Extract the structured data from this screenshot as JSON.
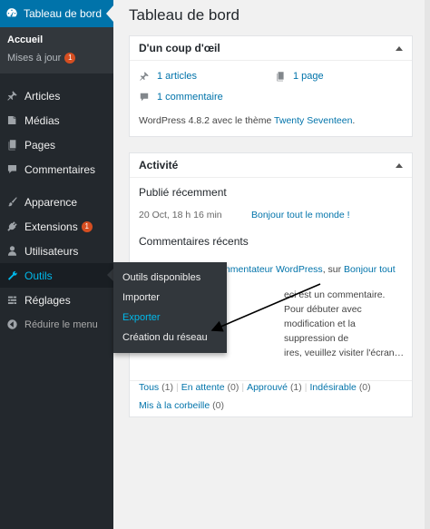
{
  "sidebar": {
    "header": {
      "label": "Tableau de bord",
      "icon": "dashboard-icon"
    },
    "submenu": [
      {
        "label": "Accueil",
        "current": true
      },
      {
        "label": "Mises à jour",
        "badge": "1"
      }
    ],
    "items": [
      {
        "label": "Articles",
        "icon": "pushpin-icon"
      },
      {
        "label": "Médias",
        "icon": "media-icon"
      },
      {
        "label": "Pages",
        "icon": "pages-icon"
      },
      {
        "label": "Commentaires",
        "icon": "comment-icon"
      },
      {
        "label": "Apparence",
        "icon": "paintbrush-icon"
      },
      {
        "label": "Extensions",
        "icon": "plugin-icon",
        "badge": "1"
      },
      {
        "label": "Utilisateurs",
        "icon": "user-icon"
      },
      {
        "label": "Outils",
        "icon": "wrench-icon"
      },
      {
        "label": "Réglages",
        "icon": "settings-icon"
      },
      {
        "label": "Réduire le menu",
        "icon": "collapse-icon"
      }
    ]
  },
  "flyout": {
    "items": [
      {
        "label": "Outils disponibles"
      },
      {
        "label": "Importer"
      },
      {
        "label": "Exporter"
      },
      {
        "label": "Création du réseau"
      }
    ]
  },
  "main": {
    "page_title": "Tableau de bord",
    "glance": {
      "title": "D'un coup d'œil",
      "articles": "1 articles",
      "pages": "1 page",
      "comments": "1 commentaire",
      "wp_version_prefix": "WordPress 4.8.2 avec le thème ",
      "theme_link": "Twenty Seventeen",
      "wp_version_suffix": "."
    },
    "activity": {
      "title": "Activité",
      "published_title": "Publié récemment",
      "published_date": "20 Oct, 18 h 16 min",
      "published_link": "Bonjour tout le monde !",
      "comments_title": "Commentaires récents",
      "comment_author_link": "mmentateur WordPress",
      "comment_on": ", sur ",
      "comment_post_link": "Bonjour tout",
      "comment_line2": "eci est un commentaire. Pour débuter avec",
      "comment_line3": "modification et la suppression de",
      "comment_line4": "ires, veuillez visiter l'écran…",
      "filters": {
        "all": "Tous",
        "all_count": "(1)",
        "pending": "En attente",
        "pending_count": "(0)",
        "approved": "Approuvé",
        "approved_count": "(1)",
        "spam": "Indésirable",
        "spam_count": "(0)",
        "trash": "Mis à la corbeille",
        "trash_count": "(0)"
      }
    }
  },
  "colors": {
    "sidebar_bg": "#23282d",
    "accent_blue": "#0073aa",
    "highlight_blue": "#00b9eb",
    "badge_red": "#d54e21"
  }
}
